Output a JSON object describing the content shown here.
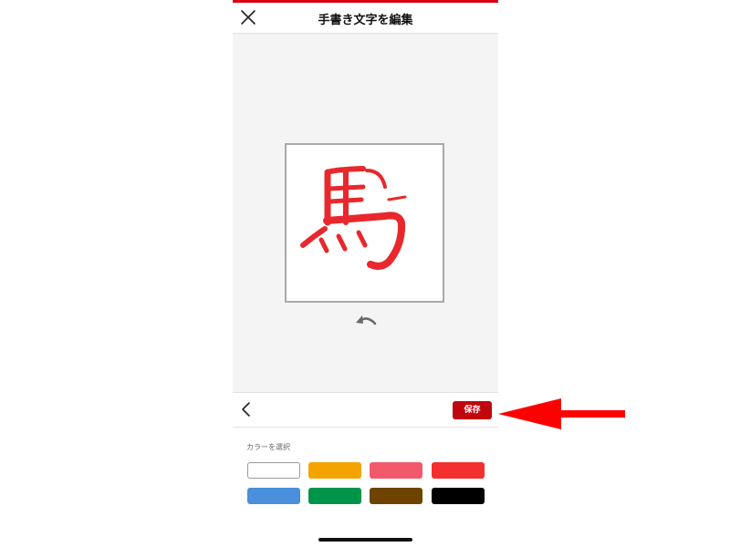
{
  "header": {
    "title": "手書き文字を編集"
  },
  "canvas": {
    "character": "馬",
    "stroke_color": "#e8282c"
  },
  "action_bar": {
    "save_label": "保存"
  },
  "color_picker": {
    "label": "カラーを選択",
    "swatches": [
      {
        "name": "white",
        "color": "#ffffff"
      },
      {
        "name": "orange",
        "color": "#f5a300"
      },
      {
        "name": "pink",
        "color": "#f25a6c"
      },
      {
        "name": "red",
        "color": "#f42f2f"
      },
      {
        "name": "blue",
        "color": "#4a8fdb"
      },
      {
        "name": "green",
        "color": "#00944a"
      },
      {
        "name": "brown",
        "color": "#6e4300"
      },
      {
        "name": "black",
        "color": "#000000"
      }
    ]
  },
  "colors": {
    "brand_red": "#d7000f",
    "save_button": "#c1060e",
    "annotation_arrow": "#ff0000",
    "canvas_background": "#f4f4f4"
  }
}
